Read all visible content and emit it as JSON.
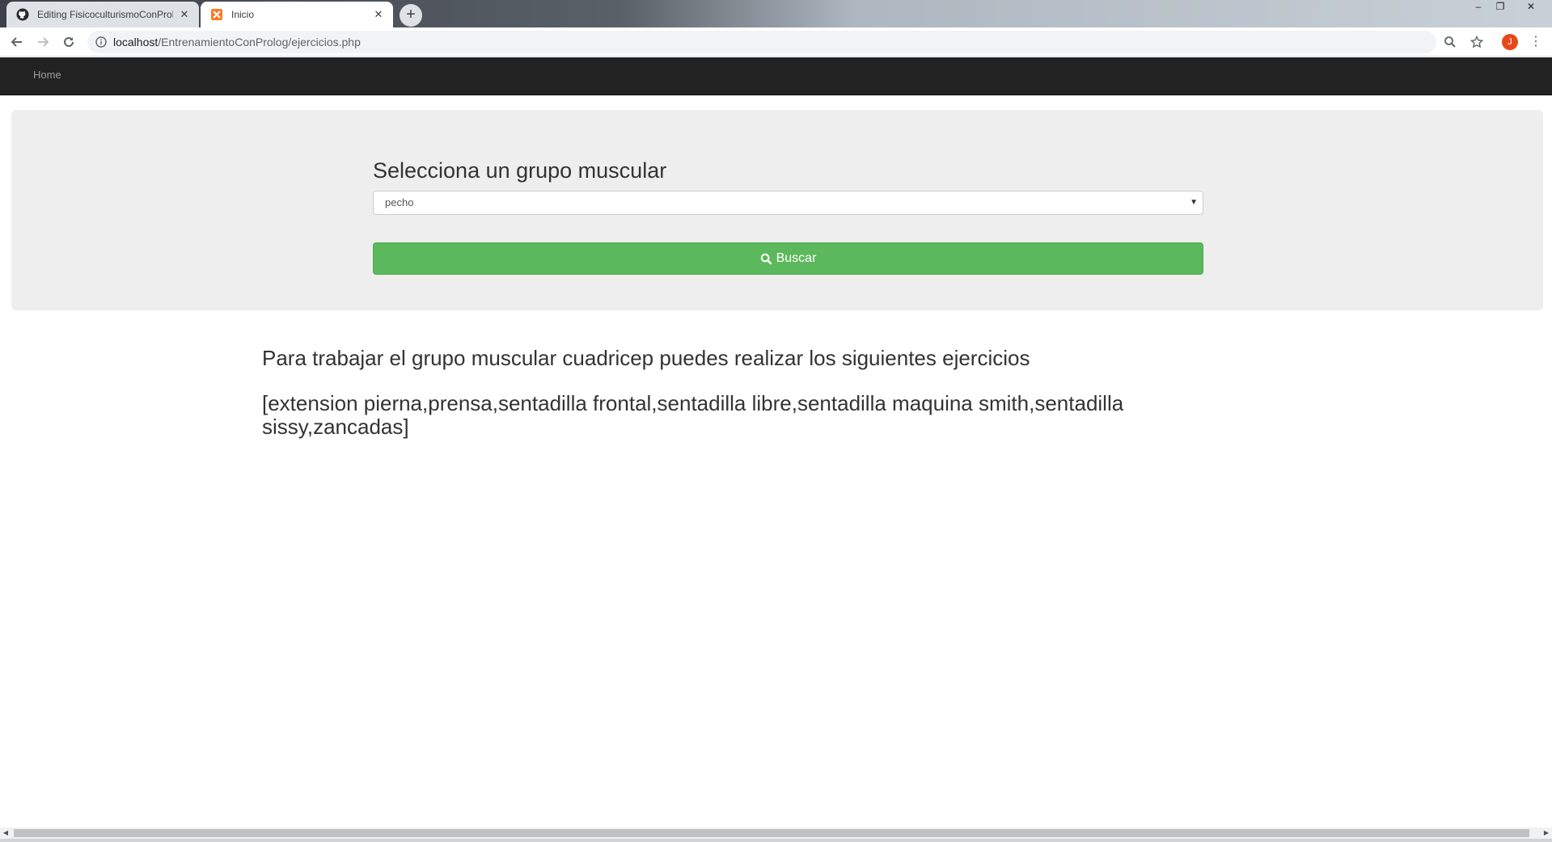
{
  "browser": {
    "tabs": [
      {
        "title": "Editing FisicoculturismoConProlo",
        "favicon": "github-icon",
        "active": false
      },
      {
        "title": "Inicio",
        "favicon": "xampp-icon",
        "active": true
      }
    ],
    "new_tab_symbol": "+",
    "url_host": "localhost",
    "url_path": "/EntrenamientoConProlog/ejercicios.php",
    "profile_initial": "J",
    "window_controls": {
      "minimize": "–",
      "restore": "❐",
      "close": "✕"
    },
    "menu_symbol": "⋮"
  },
  "navbar": {
    "home_label": "Home"
  },
  "form": {
    "label": "Selecciona un grupo muscular",
    "selected_option": "pecho",
    "button_label": "Buscar"
  },
  "result": {
    "heading": "Para trabajar el grupo muscular cuadricep puedes realizar los siguientes ejercicios",
    "exercises": "[extension pierna,prensa,sentadilla frontal,sentadilla libre,sentadilla maquina smith,sentadilla sissy,zancadas]"
  },
  "colors": {
    "navbar_bg": "#222222",
    "jumbotron_bg": "#eeeeee",
    "button_success": "#5cb85c",
    "profile_avatar": "#e8471c"
  }
}
